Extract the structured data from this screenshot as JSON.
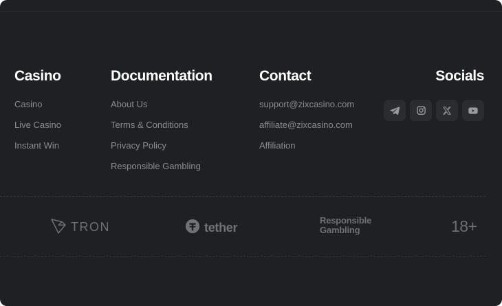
{
  "columns": {
    "casino": {
      "title": "Casino",
      "links": [
        "Casino",
        "Live Casino",
        "Instant Win"
      ]
    },
    "documentation": {
      "title": "Documentation",
      "links": [
        "About Us",
        "Terms & Conditions",
        "Privacy Policy",
        "Responsible Gambling"
      ]
    },
    "contact": {
      "title": "Contact",
      "links": [
        "support@zixcasino.com",
        "affiliate@zixcasino.com",
        "Affiliation"
      ]
    },
    "socials": {
      "title": "Socials",
      "icons": [
        "telegram-icon",
        "instagram-icon",
        "x-icon",
        "youtube-icon"
      ]
    }
  },
  "partners": {
    "tron": "TRON",
    "tether": "tether",
    "responsible_line1": "Responsible",
    "responsible_line2": "Gambling",
    "age": "18+"
  },
  "colors": {
    "background": "#1f2023",
    "title": "#ffffff",
    "link": "#8b8c90",
    "social_bg": "#2a2c30",
    "partner_logo": "#6e6f74"
  }
}
